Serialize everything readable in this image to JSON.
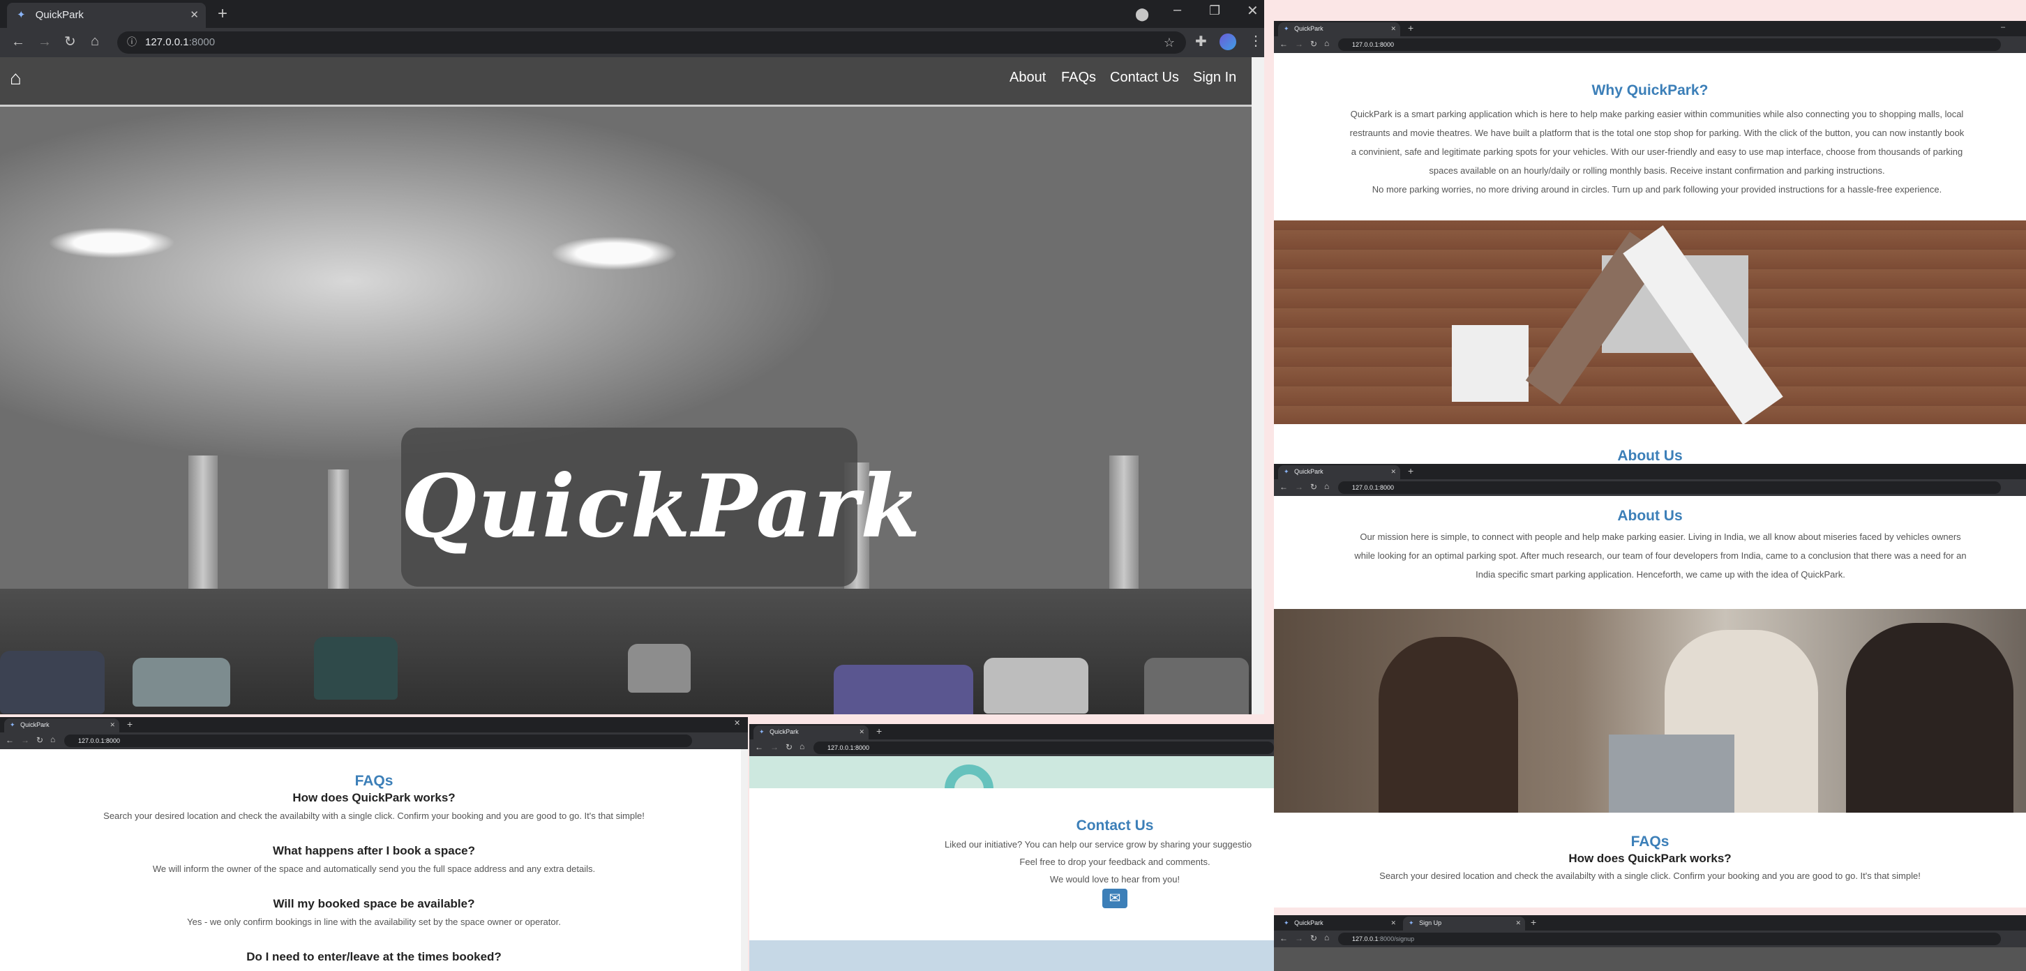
{
  "main_window": {
    "tab_title": "QuickPark",
    "url_host": "127.0.0.1",
    "url_port": ":8000",
    "nav": [
      "About",
      "FAQs",
      "Contact Us",
      "Sign In"
    ],
    "hero_title": "QuickPark"
  },
  "why_window": {
    "tab_title": "QuickPark",
    "url": "127.0.0.1:8000",
    "heading": "Why QuickPark?",
    "paragraph_lines": [
      "QuickPark is a smart parking application which is here to help make parking easier within communities while also connecting you to shopping malls, local",
      "restraunts and movie theatres. We have built a platform that is the total one stop shop for parking. With the click of the button, you can now instantly book",
      "a convinient, safe and legitimate parking spots for your vehicles. With our user-friendly and easy to use map interface, choose from thousands of parking",
      "spaces available on an hourly/daily or rolling monthly basis. Receive instant confirmation and parking instructions.",
      "No more parking worries, no more driving around in circles. Turn up and park following your provided instructions for a hassle-free experience."
    ],
    "partial_heading": "About Us"
  },
  "about_window": {
    "tab_title": "QuickPark",
    "url": "127.0.0.1:8000",
    "heading": "About Us",
    "paragraph_lines": [
      "Our mission here is simple, to connect with people and help make parking easier. Living in India, we all know about miseries faced by vehicles owners",
      "while looking for an optimal parking spot. After much research, our team of four developers from India, came to a conclusion that there was a need for an",
      "India specific smart parking application. Henceforth, we came up with the idea of QuickPark."
    ],
    "faq_heading": "FAQs",
    "faq_q": "How does QuickPark works?",
    "faq_a": "Search your desired location and check the availabilty with a single click. Confirm your booking and you are good to go. It's that simple!"
  },
  "signup_window": {
    "tab1": "QuickPark",
    "tab2": "Sign Up",
    "url_host": "127.0.0.1",
    "url_path": ":8000/signup"
  },
  "faq_window": {
    "tab_title": "QuickPark",
    "url": "127.0.0.1:8000",
    "heading": "FAQs",
    "items": [
      {
        "q": "How does QuickPark works?",
        "a": "Search your desired location and check the availabilty with a single click. Confirm your booking and you are good to go. It's that simple!"
      },
      {
        "q": "What happens after I book a space?",
        "a": "We will inform the owner of the space and automatically send you the full space address and any extra details."
      },
      {
        "q": "Will my booked space be available?",
        "a": "Yes - we only confirm bookings in line with the availability set by the space owner or operator."
      },
      {
        "q": "Do I need to enter/leave at the times booked?",
        "a": ""
      }
    ]
  },
  "contact_window": {
    "tab_title": "QuickPark",
    "url": "127.0.0.1:8000",
    "heading": "Contact Us",
    "lines": [
      "Liked our initiative? You can help our service grow by sharing your suggestio",
      "Feel free to drop your feedback and comments.",
      "We would love to hear from you!"
    ]
  },
  "colors": {
    "heading_blue": "#3c7fb8",
    "nav_bg": "#474747",
    "chrome_dark": "#202124"
  }
}
